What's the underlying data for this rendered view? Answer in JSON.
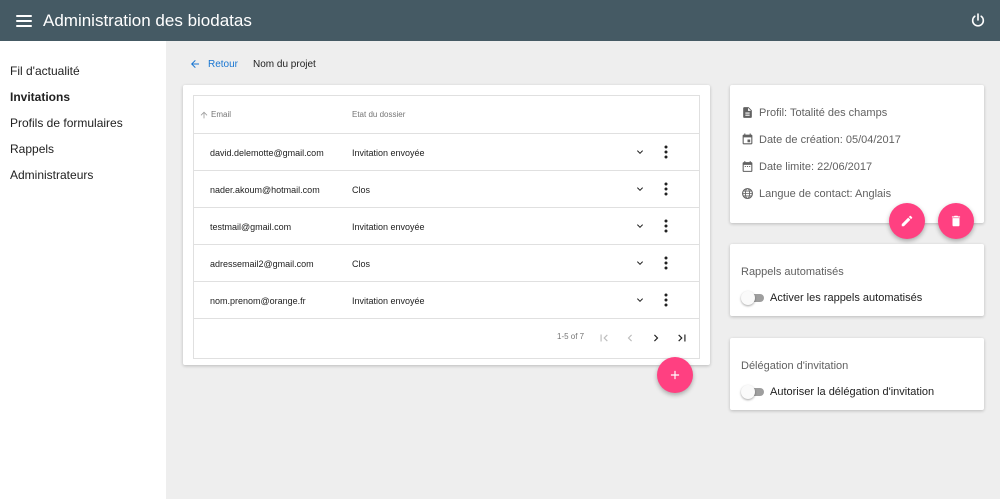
{
  "header": {
    "title": "Administration des biodatas",
    "menu_icon": "menu-icon",
    "power_icon": "power-icon",
    "background_color": "#455a64"
  },
  "sidebar": {
    "items": [
      {
        "label": "Fil d'actualité",
        "active": false
      },
      {
        "label": "Invitations",
        "active": true
      },
      {
        "label": "Profils de formulaires",
        "active": false
      },
      {
        "label": "Rappels",
        "active": false
      },
      {
        "label": "Administrateurs",
        "active": false
      }
    ]
  },
  "breadcrumb": {
    "back_label": "Retour",
    "project_name": "Nom du projet"
  },
  "table": {
    "columns": [
      "Email",
      "Etat du dossier"
    ],
    "rows": [
      {
        "email": "david.delemotte@gmail.com",
        "status": "Invitation envoyée"
      },
      {
        "email": "nader.akoum@hotmail.com",
        "status": "Clos"
      },
      {
        "email": "testmail@gmail.com",
        "status": "Invitation envoyée"
      },
      {
        "email": "adressemail2@gmail.com",
        "status": "Clos"
      },
      {
        "email": "nom.prenom@orange.fr",
        "status": "Invitation envoyée"
      }
    ],
    "pagination": {
      "range": "1-5 of 7"
    }
  },
  "project_info": {
    "profile": "Profil: Totalité des champs",
    "created": "Date de création: 05/04/2017",
    "deadline": "Date limite: 22/06/2017",
    "language": "Langue de contact: Anglais"
  },
  "reminders": {
    "title": "Rappels automatisés",
    "toggle_label": "Activer les rappels automatisés",
    "enabled": false
  },
  "delegation": {
    "title": "Délégation d'invitation",
    "toggle_label": "Autoriser la délégation d'invitation",
    "enabled": false
  },
  "colors": {
    "accent": "#ff4081",
    "link": "#1976d2"
  }
}
